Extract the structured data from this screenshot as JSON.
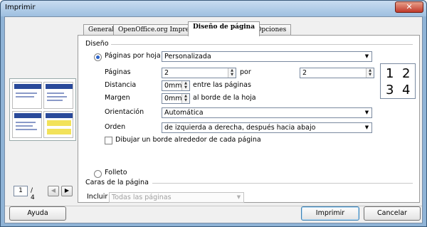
{
  "window": {
    "title": "Imprimir",
    "close_glyph": "✕"
  },
  "tabs": [
    {
      "label": "General"
    },
    {
      "label": "OpenOffice.org Impress"
    },
    {
      "label": "Diseño de página"
    },
    {
      "label": "Opciones"
    }
  ],
  "layout": {
    "section_label": "Diseño",
    "pages_per_sheet": {
      "label": "Páginas por hoja",
      "value": "Personalizada"
    },
    "pages": {
      "label": "Páginas",
      "cols": "2",
      "by_label": "por",
      "rows": "2"
    },
    "distance": {
      "label": "Distancia",
      "value": "0mm",
      "suffix": "entre las páginas"
    },
    "margin": {
      "label": "Margen",
      "value": "0mm",
      "suffix": "al borde de la hoja"
    },
    "orientation": {
      "label": "Orientación",
      "value": "Automática"
    },
    "order": {
      "label": "Orden",
      "value": "de izquierda a derecha, después hacia abajo"
    },
    "draw_border": {
      "label": "Dibujar un borde alrededor de cada página"
    },
    "brochure": {
      "label": "Folleto"
    },
    "nup_digits": [
      "1",
      "2",
      "3",
      "4"
    ]
  },
  "sides": {
    "section_label": "Caras de la página",
    "include_label": "Incluir",
    "include_value": "Todas las páginas"
  },
  "preview": {
    "page_current": "1",
    "page_total": "/ 4",
    "prev_glyph": "◀",
    "next_glyph": "▶"
  },
  "buttons": {
    "help": "Ayuda",
    "print": "Imprimir",
    "cancel": "Cancelar"
  }
}
